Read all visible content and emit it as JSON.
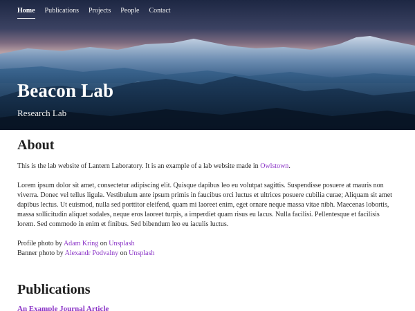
{
  "nav": {
    "items": [
      {
        "label": "Home",
        "active": true
      },
      {
        "label": "Publications",
        "active": false
      },
      {
        "label": "Projects",
        "active": false
      },
      {
        "label": "People",
        "active": false
      },
      {
        "label": "Contact",
        "active": false
      }
    ]
  },
  "banner": {
    "title": "Beacon Lab",
    "subtitle": "Research Lab"
  },
  "about": {
    "heading": "About",
    "intro_text": "This is the lab website of Lantern Laboratory. It is an example of a lab website made in ",
    "intro_link": "Owlstown",
    "intro_end": ".",
    "lorem": "Lorem ipsum dolor sit amet, consectetur adipiscing elit. Quisque dapibus leo eu volutpat sagittis. Suspendisse posuere at mauris non viverra. Donec vel tellus ligula. Vestibulum ante ipsum primis in faucibus orci luctus et ultrices posuere cubilia curae; Aliquam sit amet dapibus lectus. Ut euismod, nulla sed porttitor eleifend, quam mi laoreet enim, eget ornare neque massa vitae nibh. Maecenas lobortis, massa sollicitudin aliquet sodales, neque eros laoreet turpis, a imperdiet quam risus eu lacus. Nulla facilisi. Pellentesque et facilisis lorem. Sed commodo in enim et finibus. Sed bibendum leo eu iaculis luctus.",
    "credits": {
      "profile_prefix": "Profile photo by ",
      "profile_author": "Adam Kring",
      "on1": " on ",
      "profile_site": "Unsplash",
      "banner_prefix": "Banner photo by ",
      "banner_author": "Alexandr Podvalny",
      "on2": " on ",
      "banner_site": "Unsplash"
    }
  },
  "publications": {
    "heading": "Publications",
    "first_item": "An Example Journal Article"
  },
  "colors": {
    "link": "#8a33c6",
    "heading": "#1e1e1e"
  }
}
